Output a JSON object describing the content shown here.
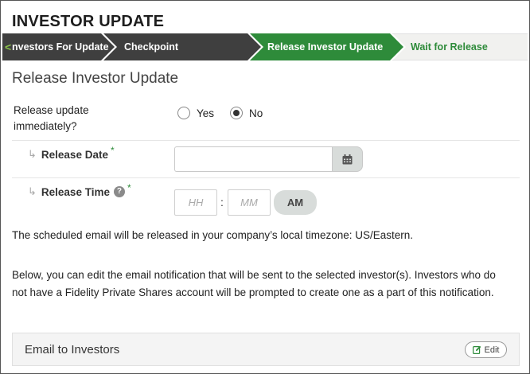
{
  "app": {
    "title": "INVESTOR UPDATE"
  },
  "stepper": {
    "back_glyph": "<",
    "steps": [
      {
        "label": "nvestors For Update",
        "state": "complete"
      },
      {
        "label": "Checkpoint",
        "state": "complete"
      },
      {
        "label": "Release Investor Update",
        "state": "active"
      },
      {
        "label": "Wait for Release",
        "state": "upcoming"
      }
    ],
    "colors": {
      "complete": "#3f3f3f",
      "active": "#2e8b3a",
      "upcoming": "#f1f1ef",
      "upcoming_text": "#2e8b3a"
    }
  },
  "section": {
    "title": "Release Investor Update"
  },
  "release_now": {
    "question": "Release update immediately?",
    "options": [
      {
        "label": "Yes",
        "checked": false
      },
      {
        "label": "No",
        "checked": true
      }
    ]
  },
  "release_date": {
    "label": "Release Date",
    "required_mark": "*",
    "value": "",
    "icon": "calendar-icon"
  },
  "release_time": {
    "label": "Release Time",
    "required_mark": "*",
    "help_glyph": "?",
    "hour_placeholder": "HH",
    "minute_placeholder": "MM",
    "separator": ":",
    "ampm": "AM"
  },
  "notes": {
    "timezone": "The scheduled email will be released in your company’s local timezone: US/Eastern.",
    "edit_info_line1": "Below, you can edit the email notification that will be sent to the selected investor(s). Investors who do",
    "edit_info_line2": "not have a Fidelity Private Shares account will be prompted to create one as a part of this notification."
  },
  "email_panel": {
    "title": "Email to Investors",
    "edit_label": "Edit",
    "edit_icon": "edit-icon"
  }
}
